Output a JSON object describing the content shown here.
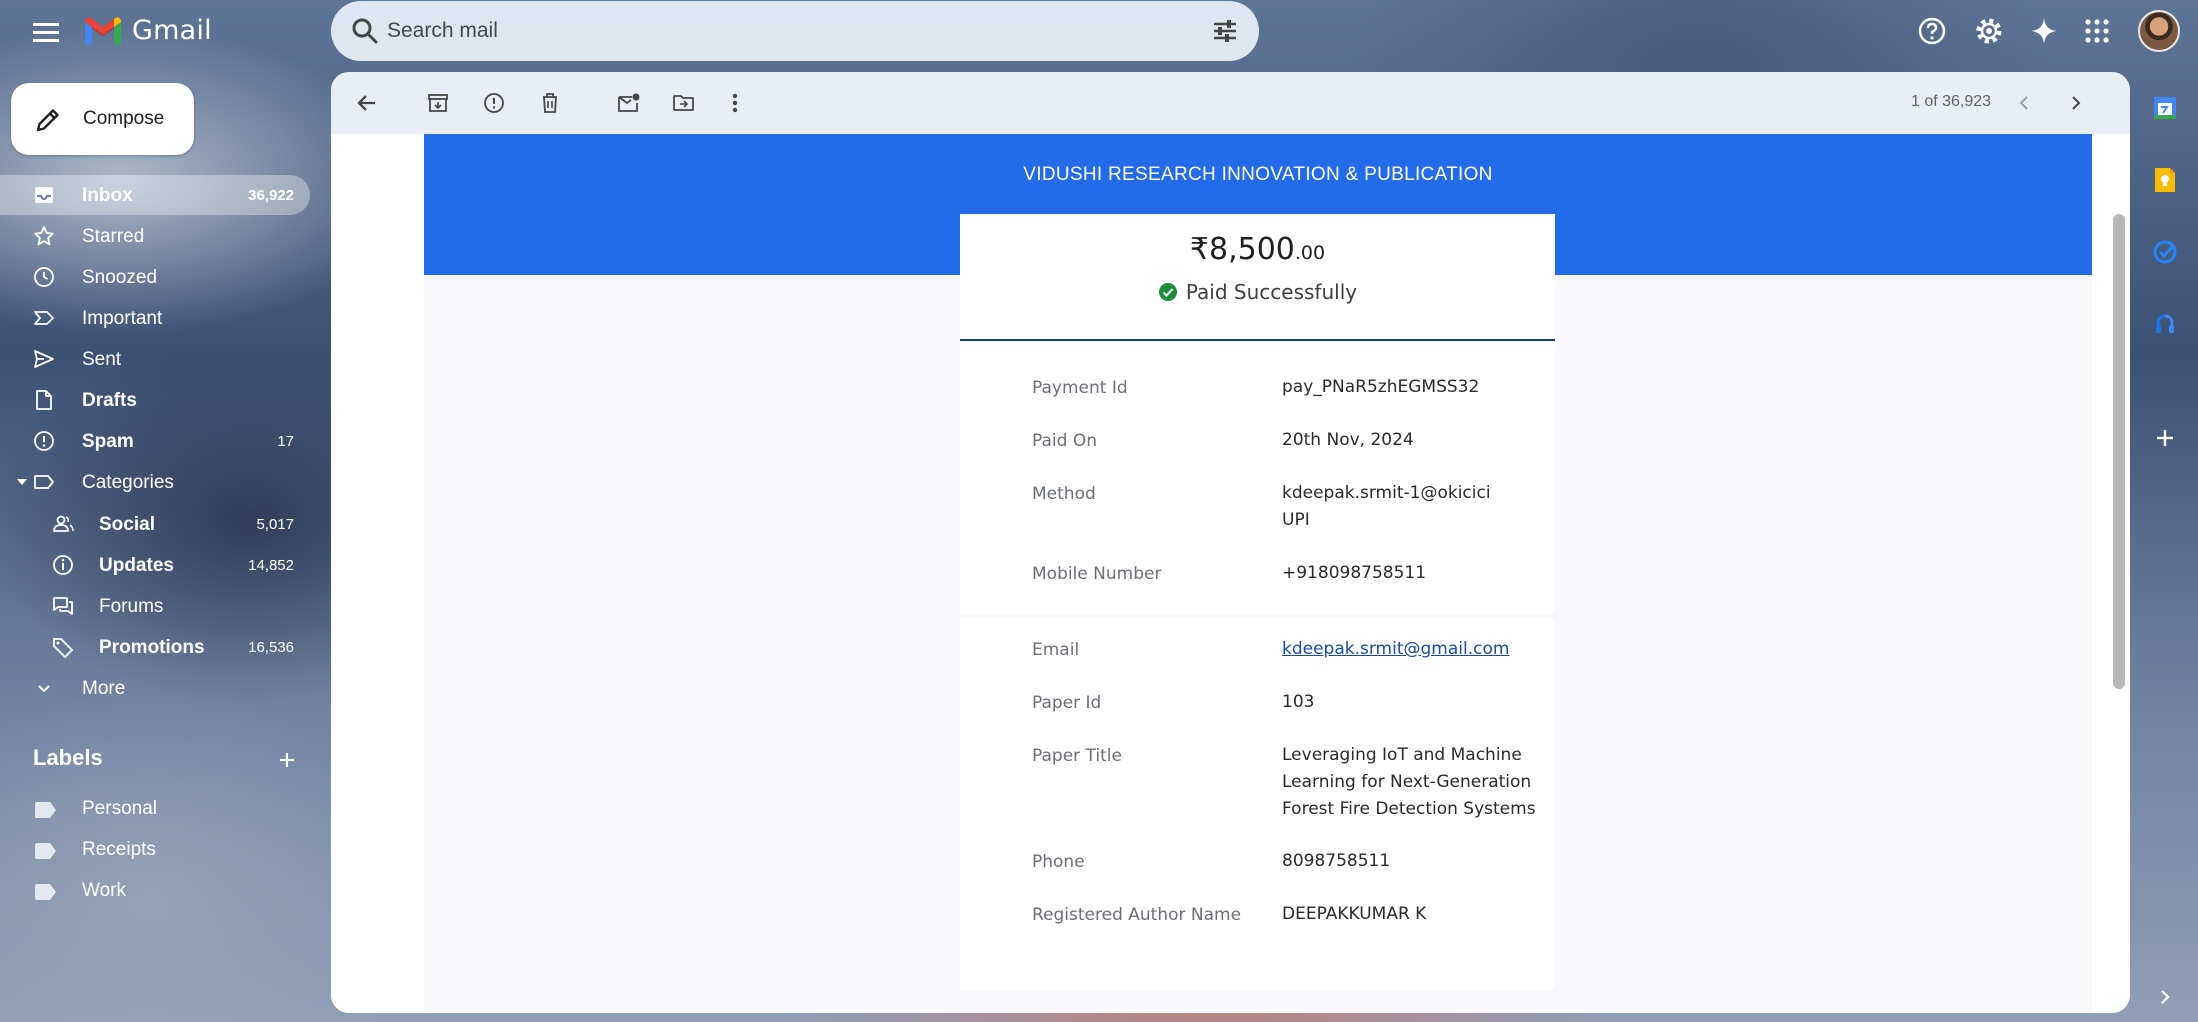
{
  "app": {
    "name": "Gmail"
  },
  "search": {
    "placeholder": "Search mail"
  },
  "compose": {
    "label": "Compose"
  },
  "nav": [
    {
      "label": "Inbox",
      "count": "36,922",
      "icon": "inbox-icon"
    },
    {
      "label": "Starred",
      "count": "",
      "icon": "star-icon"
    },
    {
      "label": "Snoozed",
      "count": "",
      "icon": "clock-icon"
    },
    {
      "label": "Important",
      "count": "",
      "icon": "important-icon"
    },
    {
      "label": "Sent",
      "count": "",
      "icon": "send-icon"
    },
    {
      "label": "Drafts",
      "count": "",
      "icon": "draft-icon"
    },
    {
      "label": "Spam",
      "count": "17",
      "icon": "spam-icon"
    },
    {
      "label": "Categories",
      "count": "",
      "icon": "label-outline-icon"
    }
  ],
  "categories": [
    {
      "label": "Social",
      "count": "5,017",
      "icon": "people-icon"
    },
    {
      "label": "Updates",
      "count": "14,852",
      "icon": "info-icon"
    },
    {
      "label": "Forums",
      "count": "",
      "icon": "forum-icon"
    },
    {
      "label": "Promotions",
      "count": "16,536",
      "icon": "tag-icon"
    }
  ],
  "more": {
    "label": "More"
  },
  "labels": {
    "title": "Labels",
    "items": [
      "Personal",
      "Receipts",
      "Work"
    ]
  },
  "pager": {
    "text": "1 of 36,923"
  },
  "email": {
    "org_title": "VIDUSHI RESEARCH INNOVATION & PUBLICATION",
    "amount_main": "₹8,500",
    "amount_decimal": ".00",
    "status": "Paid Successfully",
    "details": [
      {
        "label": "Payment Id",
        "value": "pay_PNaR5zhEGMSS32"
      },
      {
        "label": "Paid On",
        "value": "20th Nov, 2024"
      },
      {
        "label": "Method",
        "value": "kdeepak.srmit-1@okicici",
        "value2": "UPI"
      },
      {
        "label": "Mobile Number",
        "value": "+918098758511"
      }
    ],
    "details2": [
      {
        "label": "Email",
        "value": "kdeepak.srmit@gmail.com"
      },
      {
        "label": "Paper Id",
        "value": "103"
      },
      {
        "label": "Paper Title",
        "lines": [
          "Leveraging IoT and Machine",
          "Learning for Next-Generation",
          "Forest Fire Detection Systems"
        ]
      },
      {
        "label": "Phone",
        "value": "8098758511"
      },
      {
        "label": "Registered Author Name",
        "value": "DEEPAKKUMAR K"
      }
    ]
  },
  "colors": {
    "header_blue": "#236be8",
    "success_green": "#1e8e3e",
    "link_blue": "#1a4da1"
  }
}
